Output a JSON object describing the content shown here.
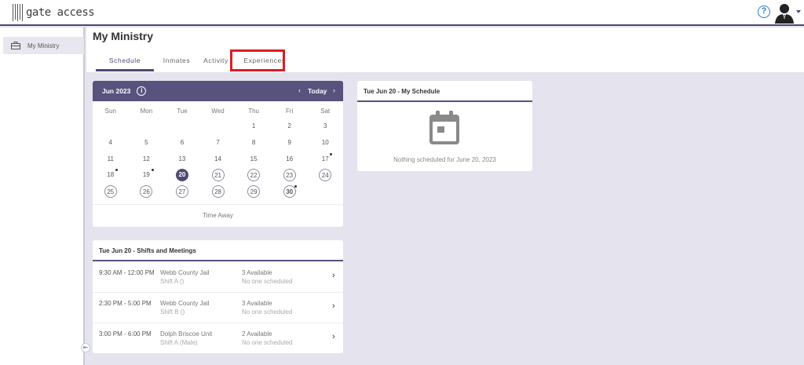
{
  "app": {
    "logo_text": "gate access",
    "help_label": "?"
  },
  "sidebar": {
    "items": [
      {
        "label": "My Ministry",
        "icon": "briefcase-icon"
      }
    ],
    "collapse_label": "⇤"
  },
  "page": {
    "title": "My Ministry",
    "tabs": [
      {
        "label": "Schedule",
        "active": true
      },
      {
        "label": "Inmates",
        "active": false
      },
      {
        "label": "Activity",
        "active": false
      },
      {
        "label": "Experiences",
        "active": false
      }
    ]
  },
  "calendar": {
    "month_label": "Jun 2023",
    "info_label": "i",
    "prev_label": "‹",
    "today_label": "Today",
    "next_label": "›",
    "weekdays": [
      "Sun",
      "Mon",
      "Tue",
      "Wed",
      "Thu",
      "Fri",
      "Sat"
    ],
    "weeks": [
      [
        "",
        "",
        "",
        "",
        "1",
        "2",
        "3"
      ],
      [
        "4",
        "5",
        "6",
        "7",
        "8",
        "9",
        "10"
      ],
      [
        "11",
        "12",
        "13",
        "14",
        "15",
        "16",
        "17"
      ],
      [
        "18",
        "19",
        "20",
        "21",
        "22",
        "23",
        "24"
      ],
      [
        "25",
        "26",
        "27",
        "28",
        "29",
        "30",
        ""
      ]
    ],
    "time_away_label": "Time Away"
  },
  "my_schedule": {
    "title": "Tue Jun 20 - My Schedule",
    "empty_text": "Nothing scheduled for June 20, 2023"
  },
  "shifts": {
    "title": "Tue Jun 20 - Shifts and Meetings",
    "rows": [
      {
        "time": "9:30 AM - 12:00 PM",
        "location": "Webb County Jail",
        "shift": "Shift A ()",
        "available": "3 Available",
        "scheduled": "No one scheduled"
      },
      {
        "time": "2:30 PM - 5:00 PM",
        "location": "Webb County Jail",
        "shift": "Shift B ()",
        "available": "3 Available",
        "scheduled": "No one scheduled"
      },
      {
        "time": "3:00 PM - 6:00 PM",
        "location": "Dolph Briscoe Unit",
        "shift": "Shift A (Male)",
        "available": "2 Available",
        "scheduled": "No one scheduled"
      }
    ]
  },
  "colors": {
    "accent": "#4f4a73",
    "highlight": "#e01b24",
    "link": "#2b7ec5"
  }
}
